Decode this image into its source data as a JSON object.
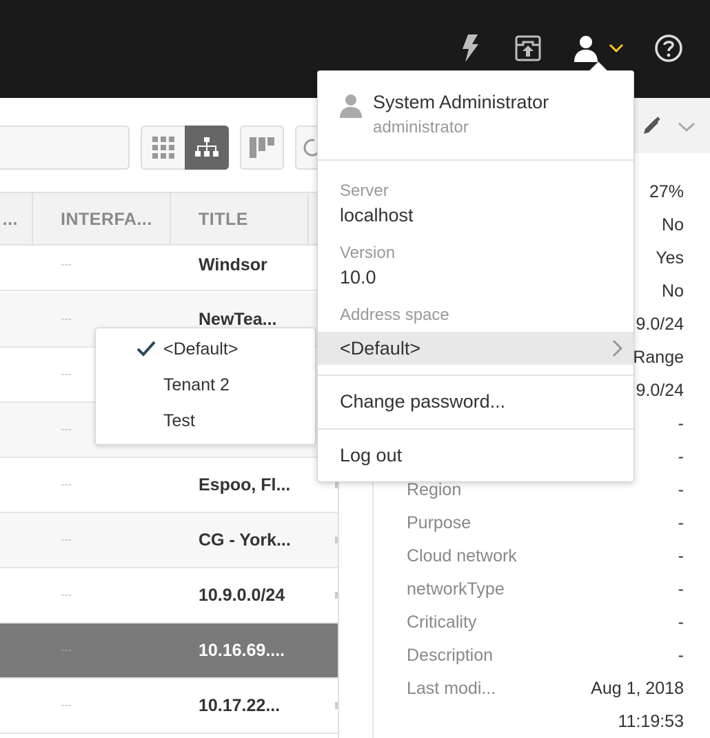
{
  "table": {
    "headers": [
      "...",
      "INTERFA...",
      "TITLE"
    ],
    "rows": [
      {
        "interface": "---",
        "title": "Windsor"
      },
      {
        "interface": "---",
        "title": "NewTea..."
      },
      {
        "interface": "---",
        "title": ""
      },
      {
        "interface": "---",
        "title": ""
      },
      {
        "interface": "---",
        "title": "Espoo, Fl..."
      },
      {
        "interface": "---",
        "title": "CG - York..."
      },
      {
        "interface": "---",
        "title": "10.9.0.0/24"
      },
      {
        "interface": "---",
        "title": "10.16.69...."
      },
      {
        "interface": "---",
        "title": "10.17.22..."
      }
    ]
  },
  "details": {
    "values_top": [
      "27%",
      "No",
      "Yes",
      "No",
      "9.0/24",
      "Range",
      "9.0/24",
      "-",
      "-"
    ],
    "fields": [
      {
        "label": "Region",
        "value": "-"
      },
      {
        "label": "Purpose",
        "value": "-"
      },
      {
        "label": "Cloud network",
        "value": "-"
      },
      {
        "label": "networkType",
        "value": "-"
      },
      {
        "label": "Criticality",
        "value": "-"
      },
      {
        "label": "Description",
        "value": "-"
      },
      {
        "label": "Last modi...",
        "value": "Aug 1, 2018"
      }
    ],
    "last_modified_time": "11:19:53"
  },
  "tenant_menu": {
    "items": [
      "<Default>",
      "Tenant 2",
      "Test"
    ],
    "selected_index": 0
  },
  "user_menu": {
    "name": "System Administrator",
    "login": "administrator",
    "server_label": "Server",
    "server_value": "localhost",
    "version_label": "Version",
    "version_value": "10.0",
    "address_space_label": "Address space",
    "address_space_value": "<Default>",
    "change_password": "Change password...",
    "log_out": "Log out"
  },
  "colors": {
    "topbar": "#1a1a1a",
    "accent_chevron": "#f5c518",
    "selected_row": "#7a7a7a",
    "active_view_button": "#666666"
  }
}
